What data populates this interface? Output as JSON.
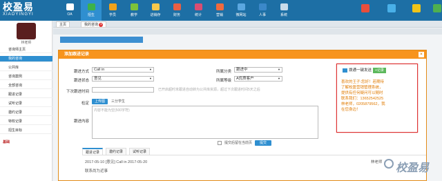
{
  "brand": {
    "cn": "校盈易",
    "en": "XIAOYINGYI"
  },
  "nav": [
    {
      "label": "OA",
      "color": "#ffffff"
    },
    {
      "label": "招生",
      "color": "#3db24a"
    },
    {
      "label": "学员",
      "color": "#f0a21a"
    },
    {
      "label": "教学",
      "color": "#7cc23a"
    },
    {
      "label": "进销存",
      "color": "#f6c84b"
    },
    {
      "label": "财务",
      "color": "#e95f43"
    },
    {
      "label": "统计",
      "color": "#d94d73"
    },
    {
      "label": "营销",
      "color": "#f06a3d"
    },
    {
      "label": "微网站",
      "color": "#5ba7e0"
    },
    {
      "label": "人事",
      "color": "#3b88c9"
    },
    {
      "label": "系统",
      "color": "#c8dbea"
    }
  ],
  "user_icons": [
    {
      "label": "",
      "color": "#e84e3c"
    },
    {
      "label": "",
      "color": "#49b0e8"
    },
    {
      "label": "",
      "color": "#f0c419"
    },
    {
      "label": "",
      "color": "#4fb04f"
    }
  ],
  "sidebar": {
    "user_name": "林老师",
    "items": [
      "咨询师主页",
      "我的咨询",
      "公共库",
      "咨询案例",
      "全部咨询",
      "跟进记录",
      "试听记录",
      "邀约记录",
      "特权记录",
      "招生目标"
    ],
    "active_index": 1,
    "section": "基础"
  },
  "page_tabs": {
    "home": "主页",
    "current": "我的咨询"
  },
  "dialog": {
    "title": "添加跟进记录",
    "close": "×",
    "fields": {
      "method_label": "跟进方式",
      "method_value": "Call in",
      "status_label": "跟进状态",
      "status_value": "意见",
      "category_label": "所属分类",
      "category_value": "跟进中",
      "level_label": "所属等级",
      "level_value": "A优质客户",
      "next_label": "下次跟进时间",
      "next_hint": "已开启超时未跟进自动转为公共库资源，超过下次跟进时间5天之后",
      "reminder_label": "检定",
      "upload_btn": "上传图",
      "learn_label": "三分学生",
      "content_label": "跟进内容",
      "content_placeholder": "内容不能为空(500字符)"
    },
    "tabs": [
      "跟进记录",
      "邀约记录",
      "试听记录"
    ],
    "active_tab": 0,
    "checkbox_label": "提交后留在当前页",
    "submit": "提交",
    "record": {
      "text": "2017-05-10 [意见] Call in 2017-05-20",
      "author": "林老师",
      "remark": "联系尚为近事"
    }
  },
  "popup": {
    "title": "拨通一键发送",
    "button": "+记录",
    "text": "喜欢的王子:您好！若期待了解校盈营销管理系统，提供有任何疑问可以随时联系我们：13652542525林老师，0205879562，我在您身边！"
  },
  "watermark": "校盈易"
}
